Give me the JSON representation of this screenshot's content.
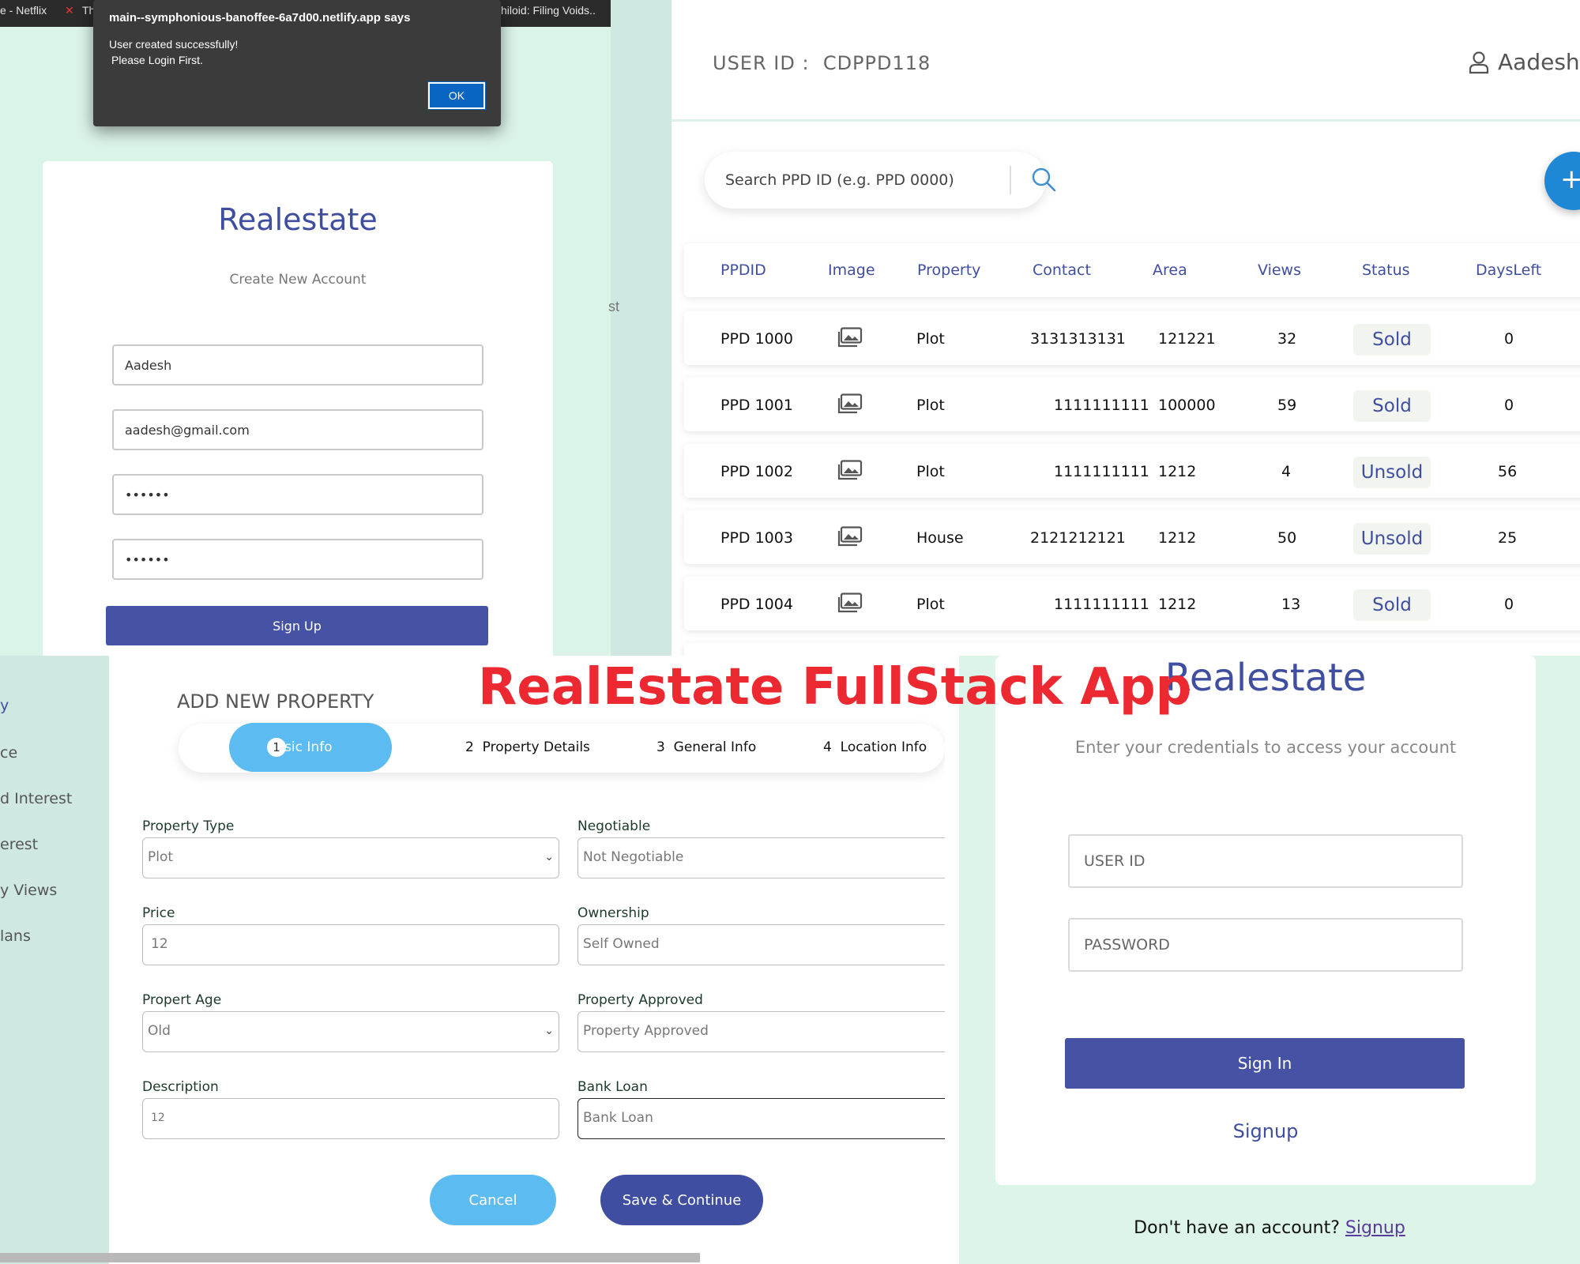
{
  "browser_tabs": [
    "e - Netflix",
    "Th",
    "hiloid: Filing Voids.."
  ],
  "alert": {
    "title": "main--symphonious-banoffee-6a7d00.netlify.app says",
    "line1": "User created successfully!",
    "line2": "Please Login First.",
    "ok_label": "OK"
  },
  "stray_text": "st",
  "signup": {
    "brand": "Realestate",
    "subtitle": "Create New Account",
    "name_value": "Aadesh",
    "email_value": "aadesh@gmail.com",
    "password_value": "••••••",
    "confirm_value": "••••••",
    "button_label": "Sign Up"
  },
  "dashboard": {
    "user_id_label": "USER ID :",
    "user_id": "CDPPD118",
    "username": "Aadesh",
    "search_placeholder": "Search PPD ID (e.g. PPD 0000)",
    "add_label": "+",
    "columns": [
      "PPDID",
      "Image",
      "Property",
      "Contact",
      "Area",
      "Views",
      "Status",
      "DaysLeft"
    ],
    "rows": [
      {
        "ppdid": "PPD 1000",
        "property": "Plot",
        "contact": "3131313131",
        "area": "121221",
        "views": "32",
        "status": "Sold",
        "days_left": "0"
      },
      {
        "ppdid": "PPD 1001",
        "property": "Plot",
        "contact": "1111111111",
        "area": "100000",
        "views": "59",
        "status": "Sold",
        "days_left": "0"
      },
      {
        "ppdid": "PPD 1002",
        "property": "Plot",
        "contact": "1111111111",
        "area": "1212",
        "views": "4",
        "status": "Unsold",
        "days_left": "56"
      },
      {
        "ppdid": "PPD 1003",
        "property": "House",
        "contact": "2121212121",
        "area": "1212",
        "views": "50",
        "status": "Unsold",
        "days_left": "25"
      },
      {
        "ppdid": "PPD 1004",
        "property": "Plot",
        "contact": "1111111111",
        "area": "1212",
        "views": "13",
        "status": "Sold",
        "days_left": "0"
      }
    ]
  },
  "banner": "RealEstate FullStack App",
  "add_property": {
    "sidebar": [
      "y",
      "ce",
      "d Interest",
      "erest",
      "y Views",
      "lans"
    ],
    "title": "ADD NEW PROPERTY",
    "steps": [
      {
        "num": "1",
        "label": "Basic Info"
      },
      {
        "num": "2",
        "label": "Property Details"
      },
      {
        "num": "3",
        "label": "General Info"
      },
      {
        "num": "4",
        "label": "Location Info"
      }
    ],
    "fields": {
      "property_type": {
        "label": "Property Type",
        "value": "Plot"
      },
      "negotiable": {
        "label": "Negotiable",
        "value": "Not Negotiable"
      },
      "price": {
        "label": "Price",
        "value": "12"
      },
      "ownership": {
        "label": "Ownership",
        "value": "Self Owned"
      },
      "property_age": {
        "label": "Propert Age",
        "value": "Old"
      },
      "property_approved": {
        "label": "Property Approved",
        "value": "Property Approved"
      },
      "description": {
        "label": "Description",
        "value": "12"
      },
      "bank_loan": {
        "label": "Bank Loan",
        "value": "Bank Loan"
      }
    },
    "cancel_label": "Cancel",
    "save_label": "Save & Continue"
  },
  "signin": {
    "brand": "Realestate",
    "subtitle": "Enter your credentials to access your account",
    "userid_placeholder": "USER ID",
    "password_placeholder": "PASSWORD",
    "button_label": "Sign In",
    "signup_link": "Signup",
    "footer_text": "Don't have an account?",
    "footer_link": "Signup"
  },
  "colors": {
    "brand": "#3f4ea0",
    "accent_light": "#5cbcf2",
    "mint": "#dbf4e9",
    "banner_red": "#ec2830"
  }
}
